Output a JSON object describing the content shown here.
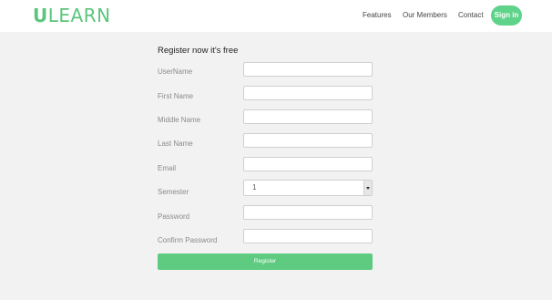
{
  "header": {
    "logo_first": "U",
    "logo_rest": "LEARN",
    "nav": {
      "features": "Features",
      "members": "Our Members",
      "contact": "Contact",
      "signin": "Sign in"
    }
  },
  "form": {
    "title": "Register now it's free",
    "fields": {
      "username": {
        "label": "UserName",
        "value": ""
      },
      "first_name": {
        "label": "First Name",
        "value": ""
      },
      "middle_name": {
        "label": "Middle Name",
        "value": ""
      },
      "last_name": {
        "label": "Last Name",
        "value": ""
      },
      "email": {
        "label": "Email",
        "value": ""
      },
      "semester": {
        "label": "Semester",
        "selected": "1"
      },
      "password": {
        "label": "Password",
        "value": ""
      },
      "confirm_password": {
        "label": "Confirm Password",
        "value": ""
      }
    },
    "submit_label": "Register"
  },
  "colors": {
    "accent": "#5cc57d",
    "button": "#5ecb80",
    "page_background": "#f2f2f2"
  }
}
